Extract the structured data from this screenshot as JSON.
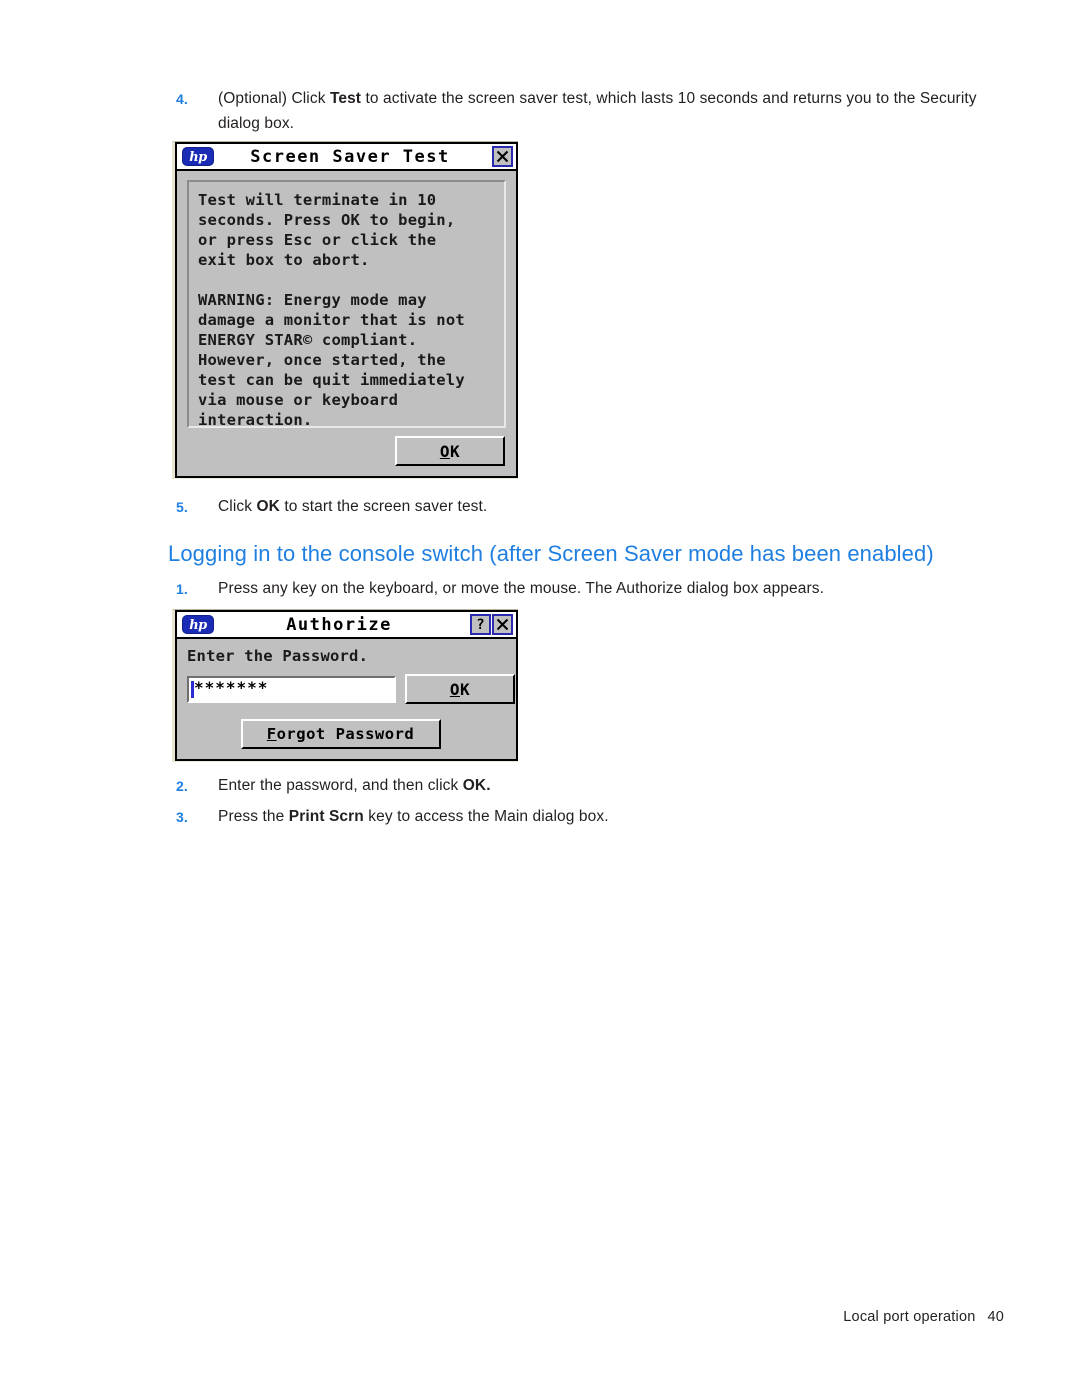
{
  "steps": {
    "step4": {
      "num": "4.",
      "pre": "(Optional) Click ",
      "bold": "Test",
      "post": " to activate the screen saver test, which lasts 10 seconds and returns you to the Security dialog box."
    },
    "step5": {
      "num": "5.",
      "pre": "Click ",
      "bold": "OK",
      "post": " to start the screen saver test."
    },
    "step1": {
      "num": "1.",
      "pre": "Press any key on the keyboard, or move the mouse. The Authorize dialog box appears.",
      "bold": "",
      "post": ""
    },
    "step2": {
      "num": "2.",
      "pre": "Enter the password, and then click ",
      "bold": "OK.",
      "post": ""
    },
    "step3": {
      "num": "3.",
      "pre": "Press the ",
      "bold": "Print Scrn",
      "post": " key to access the Main dialog box."
    }
  },
  "section_heading": "Logging in to the console switch (after Screen Saver mode has been enabled)",
  "screen_saver_test_dialog": {
    "logo": "hp",
    "title": "Screen Saver Test",
    "close_icon": "close-icon",
    "body_text": "Test will terminate in 10\nseconds. Press OK to begin,\nor press Esc or click the\nexit box to abort.\n\nWARNING: Energy mode may\ndamage a monitor that is not\nENERGY STAR© compliant.\nHowever, once started, the\ntest can be quit immediately\nvia mouse or keyboard\ninteraction.",
    "ok_button": {
      "accel": "O",
      "rest": "K"
    }
  },
  "authorize_dialog": {
    "logo": "hp",
    "title": "Authorize",
    "help_icon": "?",
    "close_icon": "close-icon",
    "label": "Enter the Password.",
    "password_value": "*******",
    "ok_button": {
      "accel": "O",
      "rest": "K"
    },
    "forgot_button": {
      "accel": "F",
      "rest": "orgot Password"
    }
  },
  "footer": {
    "label": "Local port operation",
    "page": "40"
  },
  "colors": {
    "accent_blue": "#1f7fe0",
    "dialog_gray": "#c0c0c0",
    "hp_logo_blue": "#1a2bb5",
    "titlebar_button_border": "#2a2ab0",
    "caret_blue": "#2b2bd6"
  }
}
